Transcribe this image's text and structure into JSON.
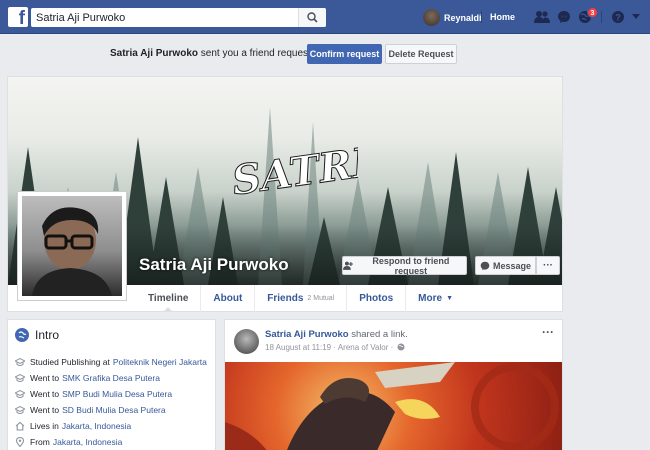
{
  "header": {
    "logo_letter": "f",
    "search": {
      "value": "Satria Aji Purwoko",
      "placeholder": "Search"
    },
    "user_name": "Reynaldi",
    "home_label": "Home",
    "notification_count": "3"
  },
  "friend_request": {
    "sender": "Satria Aji Purwoko",
    "text": " sent you a friend request",
    "confirm_label": "Confirm request",
    "delete_label": "Delete Request"
  },
  "profile": {
    "name": "Satria Aji Purwoko",
    "cover_text": "SATRIA",
    "respond_label": "Respond to friend request",
    "message_label": "Message",
    "more_label": "···",
    "tabs": [
      {
        "label": "Timeline"
      },
      {
        "label": "About"
      },
      {
        "label": "Friends",
        "sub": "2 Mutual"
      },
      {
        "label": "Photos"
      },
      {
        "label": "More",
        "caret": "▼"
      }
    ]
  },
  "intro": {
    "title": "Intro",
    "items": [
      {
        "prefix": "Studied Publishing at",
        "link": "Politeknik Negeri Jakarta",
        "icon": "graduation-cap-icon"
      },
      {
        "prefix": "Went to",
        "link": "SMK Grafika Desa Putera",
        "icon": "graduation-cap-icon"
      },
      {
        "prefix": "Went to",
        "link": "SMP Budi Mulia Desa Putera",
        "icon": "graduation-cap-icon"
      },
      {
        "prefix": "Went to",
        "link": "SD Budi Mulia Desa Putera",
        "icon": "graduation-cap-icon"
      },
      {
        "prefix": "Lives in",
        "link": "Jakarta, Indonesia",
        "icon": "home-icon"
      },
      {
        "prefix": "From",
        "link": "Jakarta, Indonesia",
        "icon": "location-pin-icon"
      }
    ]
  },
  "post": {
    "author": "Satria Aji Purwoko",
    "action": " shared a link.",
    "date": "18 August at 11:19",
    "separator": " · ",
    "location": "Arena of Valor",
    "privacy_symbol": " ·",
    "menu_label": "···"
  },
  "colors": {
    "brand_blue": "#3b5998",
    "button_blue": "#4267b2",
    "link_blue": "#365899",
    "badge_red": "#fa3e3e"
  }
}
